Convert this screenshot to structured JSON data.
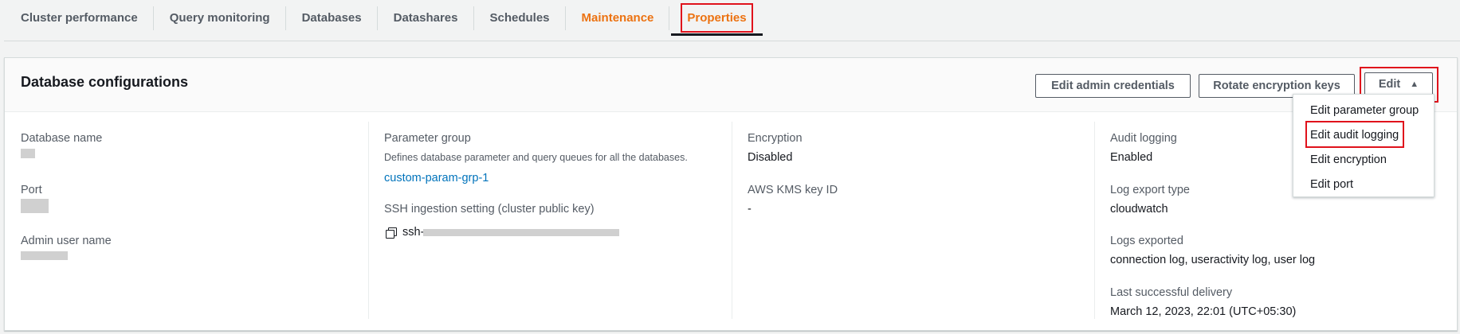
{
  "tabs": [
    {
      "label": "Cluster performance"
    },
    {
      "label": "Query monitoring"
    },
    {
      "label": "Databases"
    },
    {
      "label": "Datashares"
    },
    {
      "label": "Schedules"
    },
    {
      "label": "Maintenance"
    },
    {
      "label": "Properties"
    }
  ],
  "panel": {
    "title": "Database configurations",
    "buttons": {
      "edit_admin": "Edit admin credentials",
      "rotate_keys": "Rotate encryption keys",
      "edit": "Edit"
    }
  },
  "col1": {
    "db_name_label": "Database name",
    "port_label": "Port",
    "admin_user_label": "Admin user name"
  },
  "col2": {
    "param_group_label": "Parameter group",
    "param_group_desc": "Defines database parameter and query queues for all the databases.",
    "param_group_value": "custom-param-grp-1",
    "ssh_label": "SSH ingestion setting (cluster public key)",
    "ssh_value_prefix": "ssh-"
  },
  "col3": {
    "encryption_label": "Encryption",
    "encryption_value": "Disabled",
    "kms_label": "AWS KMS key ID",
    "kms_value": "-"
  },
  "col4": {
    "audit_label": "Audit logging",
    "audit_value": "Enabled",
    "export_type_label": "Log export type",
    "export_type_value": "cloudwatch",
    "logs_exported_label": "Logs exported",
    "logs_exported_value": "connection log, useractivity log, user log",
    "last_delivery_label": "Last successful delivery",
    "last_delivery_value": "March 12, 2023, 22:01 (UTC+05:30)"
  },
  "dropdown": {
    "items": [
      {
        "label": "Edit parameter group"
      },
      {
        "label": "Edit audit logging"
      },
      {
        "label": "Edit encryption"
      },
      {
        "label": "Edit port"
      }
    ]
  },
  "colors": {
    "accent": "#ec7211",
    "link": "#0073bb",
    "highlight": "#e0121c"
  }
}
